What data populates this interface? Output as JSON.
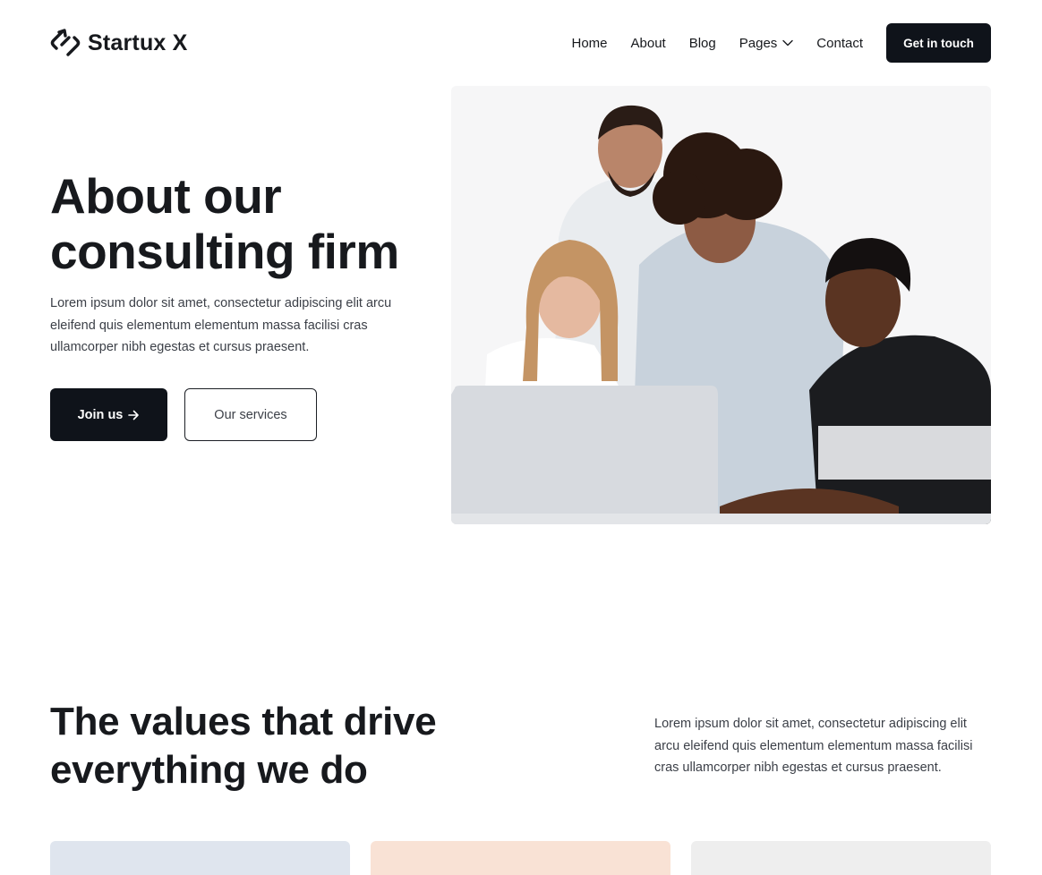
{
  "brand": {
    "name": "Startux X",
    "logo_icon": "link-arrow-icon"
  },
  "nav": {
    "items": [
      {
        "label": "Home"
      },
      {
        "label": "About"
      },
      {
        "label": "Blog"
      },
      {
        "label": "Pages",
        "has_dropdown": true,
        "icon": "chevron-down-icon"
      },
      {
        "label": "Contact"
      }
    ],
    "cta_label": "Get in touch"
  },
  "hero": {
    "title": "About our consulting firm",
    "text": "Lorem ipsum dolor sit amet, consectetur adipiscing elit arcu eleifend quis elementum elementum massa facilisi cras ullamcorper nibh egestas et cursus praesent.",
    "primary_button": "Join us",
    "primary_button_icon": "arrow-right-icon",
    "secondary_button": "Our services"
  },
  "values": {
    "title": "The values that drive everything we do",
    "text": "Lorem ipsum dolor sit amet, consectetur adipiscing elit arcu eleifend quis elementum elementum massa facilisi cras ullamcorper nibh egestas et cursus praesent."
  },
  "colors": {
    "primary": "#0f131a",
    "text": "#17191d",
    "body_text": "#3c4048",
    "card_1": "#dfe5ee",
    "card_2": "#f9e2d5",
    "card_3": "#eeeeee"
  }
}
